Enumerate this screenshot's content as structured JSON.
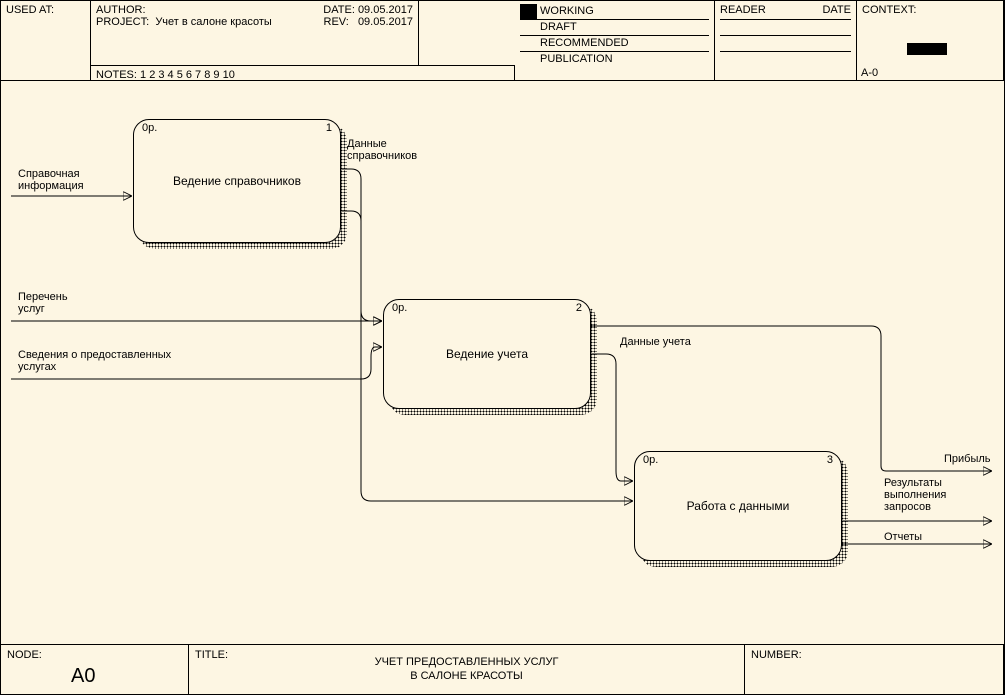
{
  "header": {
    "used_at_label": "USED AT:",
    "author_label": "AUTHOR:",
    "project_label": "PROJECT:",
    "project_value": "Учет в салоне красоты",
    "date_label": "DATE:",
    "date_value": "09.05.2017",
    "rev_label": "REV:",
    "rev_value": "09.05.2017",
    "notes_label": "NOTES:",
    "notes_value": "1  2  3  4  5  6  7  8  9  10",
    "status": {
      "working": "WORKING",
      "draft": "DRAFT",
      "recommended": "RECOMMENDED",
      "publication": "PUBLICATION"
    },
    "reader_label": "READER",
    "reader_date": "DATE",
    "context_label": "CONTEXT:",
    "context_node": "A-0"
  },
  "activities": {
    "a1": {
      "tag": "0р.",
      "num": "1",
      "label": "Ведение справочников"
    },
    "a2": {
      "tag": "0р.",
      "num": "2",
      "label": "Ведение учета"
    },
    "a3": {
      "tag": "0р.",
      "num": "3",
      "label": "Работа с данными"
    }
  },
  "flows": {
    "in1": "Справочная\nинформация",
    "in2": "Перечень\nуслуг",
    "in3": "Сведения о предоставленных\nуслугах",
    "d1": "Данные\nсправочников",
    "d2": "Данные учета",
    "out1": "Прибыль",
    "out2": "Результаты\nвыполнения\nзапросов",
    "out3": "Отчеты"
  },
  "footer": {
    "node_label": "NODE:",
    "node_value": "A0",
    "title_label": "TITLE:",
    "title_value": "УЧЕТ ПРЕДОСТАВЛЕННЫХ УСЛУГ\nВ САЛОНЕ КРАСОТЫ",
    "number_label": "NUMBER:"
  }
}
